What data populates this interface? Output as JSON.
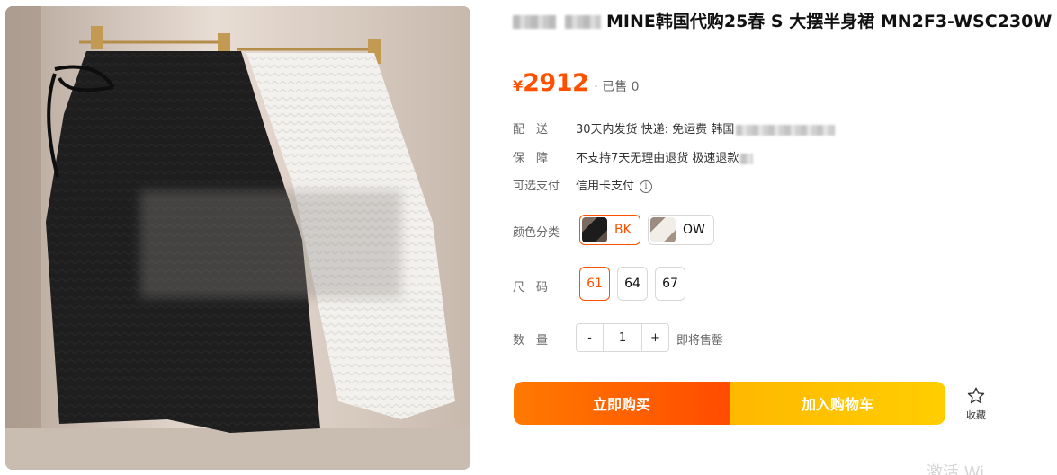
{
  "product": {
    "title": "MINE韩国代购25春 S 大摆半身裙 MN2F3-WSC230W",
    "price_symbol": "¥",
    "price": "2912",
    "sold": "· 已售 0"
  },
  "shipping": {
    "label": "配　送",
    "value": "30天内发货  快递: 免运费  韩国"
  },
  "guarantee": {
    "label": "保　障",
    "value": "不支持7天无理由退货 极速退款"
  },
  "payment": {
    "label": "可选支付",
    "value": "信用卡支付",
    "info_icon": "i"
  },
  "color": {
    "label": "颜色分类",
    "options": [
      "BK",
      "OW"
    ],
    "selected": "BK"
  },
  "size": {
    "label": "尺　码",
    "options": [
      "61",
      "64",
      "67"
    ],
    "selected": "61"
  },
  "quantity": {
    "label": "数　量",
    "minus": "-",
    "value": "1",
    "plus": "+",
    "note": "即将售罄"
  },
  "actions": {
    "buy_now": "立即购买",
    "add_to_cart": "加入购物车",
    "favorite": "收藏"
  },
  "colors": {
    "accent": "#ff5000",
    "buy_gradient": [
      "#ff7a00",
      "#ff4c00"
    ],
    "cart_gradient": [
      "#ffb800",
      "#ffce00"
    ]
  },
  "watermark": "激活 Wi"
}
